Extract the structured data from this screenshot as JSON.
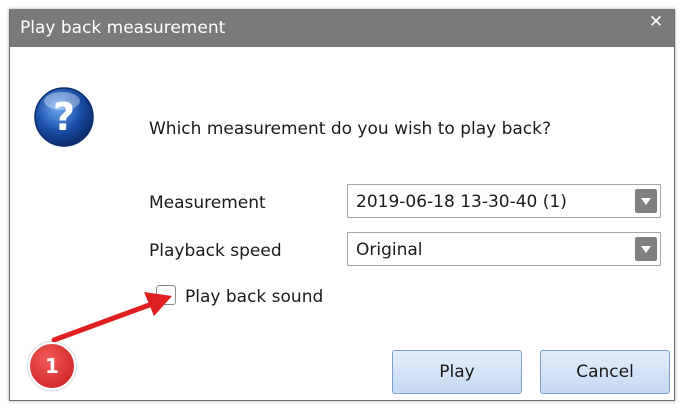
{
  "window": {
    "title": "Play back measurement",
    "close_glyph": "✕"
  },
  "prompt": {
    "question": "Which measurement do you wish to play back?",
    "icon": "question-icon"
  },
  "form": {
    "measurement_label": "Measurement",
    "measurement_value": "2019-06-18 13-30-40 (1)",
    "speed_label": "Playback speed",
    "speed_value": "Original",
    "sound_label": "Play back sound",
    "sound_checked": false
  },
  "buttons": {
    "play_label": "Play",
    "cancel_label": "Cancel"
  },
  "annotation": {
    "step_number": "1",
    "color": "#e02020"
  },
  "colors": {
    "titlebar": "#7a7a7a",
    "button_bg": "#d2e3f8",
    "icon_blue": "#1a4fa8"
  }
}
